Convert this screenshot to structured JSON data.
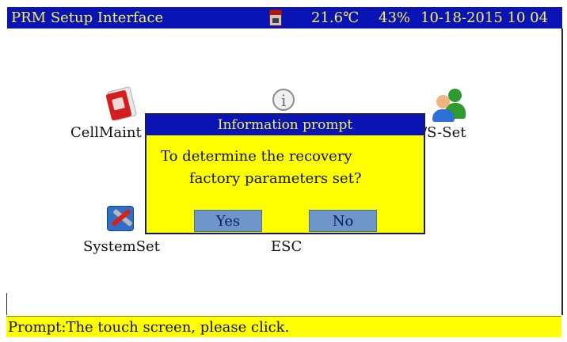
{
  "title_bar": {
    "title": "PRM Setup Interface",
    "storage_icon": "sd-card-icon",
    "temperature": "21.6℃",
    "humidity": "43%",
    "datetime": "10-18-2015 10 04"
  },
  "desktop": {
    "items": [
      {
        "label": "CellMaint",
        "icon": "cell-maintenance-icon"
      },
      {
        "label": "",
        "icon": "info-icon"
      },
      {
        "label": "I/S-Set",
        "icon": "users-icon"
      },
      {
        "label": "SystemSet",
        "icon": "system-tools-icon"
      },
      {
        "label": "ESC",
        "icon": ""
      }
    ]
  },
  "dialog": {
    "title": "Information prompt",
    "message_line1": "To determine the recovery",
    "message_line2": "factory parameters set?",
    "yes_label": "Yes",
    "no_label": "No"
  },
  "prompt_bar": {
    "text": "Prompt:The touch screen, please click."
  },
  "colors": {
    "title_bar_bg": "#0a14b4",
    "title_text": "#f5f05a",
    "dialog_bg": "#ffff00",
    "button_bg": "#6e96c8",
    "prompt_bg": "#ffff00"
  }
}
